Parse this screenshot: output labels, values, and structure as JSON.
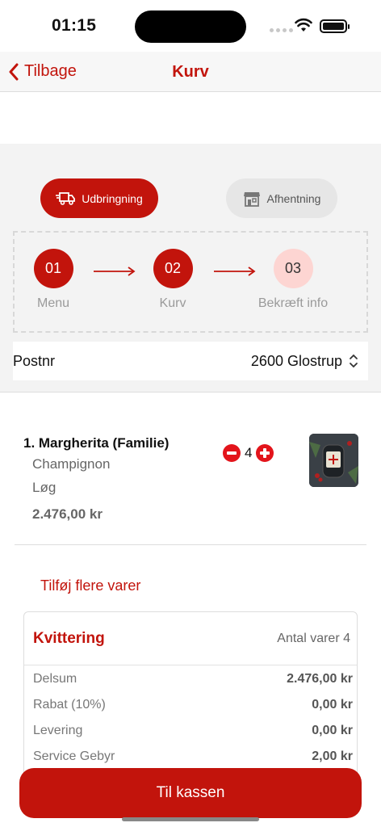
{
  "status": {
    "time": "01:15"
  },
  "nav": {
    "back_label": "Tilbage",
    "title": "Kurv"
  },
  "order_mode": {
    "delivery_label": "Udbringning",
    "pickup_label": "Afhentning",
    "selected": "delivery"
  },
  "steps": [
    {
      "number": "01",
      "label": "Menu",
      "state": "active"
    },
    {
      "number": "02",
      "label": "Kurv",
      "state": "active"
    },
    {
      "number": "03",
      "label": "Bekræft info",
      "state": "pending"
    }
  ],
  "postnr": {
    "label": "Postnr",
    "value": "2600 Glostrup"
  },
  "cart_item": {
    "name": "1. Margherita (Familie)",
    "options": [
      "Champignon",
      "Løg"
    ],
    "price": "2.476,00 kr",
    "quantity": "4"
  },
  "add_more_label": "Tilføj flere varer",
  "receipt": {
    "title": "Kvittering",
    "count_label": "Antal varer 4",
    "rows": [
      {
        "label": "Delsum",
        "value": "2.476,00 kr"
      },
      {
        "label": "Rabat (10%)",
        "value": "0,00 kr"
      },
      {
        "label": "Levering",
        "value": "0,00 kr"
      },
      {
        "label": "Service Gebyr",
        "value": "2,00 kr"
      }
    ]
  },
  "checkout_label": "Til kassen",
  "colors": {
    "brand_red": "#c2140c",
    "pending_step": "#fdd5d2",
    "qty_button": "#e3141b"
  }
}
